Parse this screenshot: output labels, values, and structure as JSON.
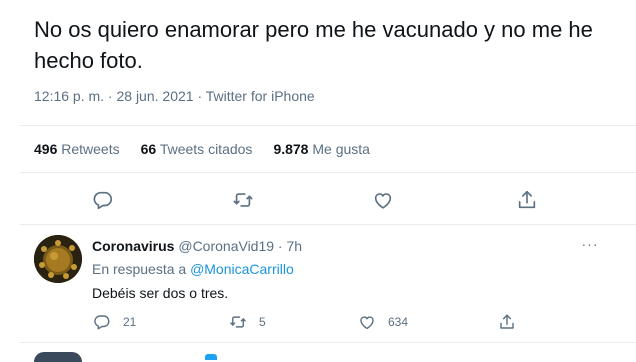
{
  "tweet": {
    "text": "No os quiero enamorar pero me he vacunado y no me he hecho foto.",
    "meta": "12:16 p. m. · 28 jun. 2021 · Twitter for iPhone",
    "stats": {
      "retweets_num": "496",
      "retweets_label": "Retweets",
      "quotes_num": "66",
      "quotes_label": "Tweets citados",
      "likes_num": "9.878",
      "likes_label": "Me gusta"
    },
    "actions": [
      "reply-icon",
      "retweet-icon",
      "like-icon",
      "share-icon"
    ]
  },
  "reply": {
    "name": "Coronavirus",
    "handle": "@CoronaVid19 · 7h",
    "more": "···",
    "in_reply_prefix": "En respuesta a",
    "in_reply_mention": "@MonicaCarrillo",
    "text": "Debéis ser dos o tres.",
    "counts": {
      "replies": "21",
      "retweets": "5",
      "likes": "634"
    }
  },
  "colors": {
    "text": "#0f1419",
    "muted": "#5b7083",
    "link": "#1b95e0",
    "divider": "#e6ecf0"
  }
}
